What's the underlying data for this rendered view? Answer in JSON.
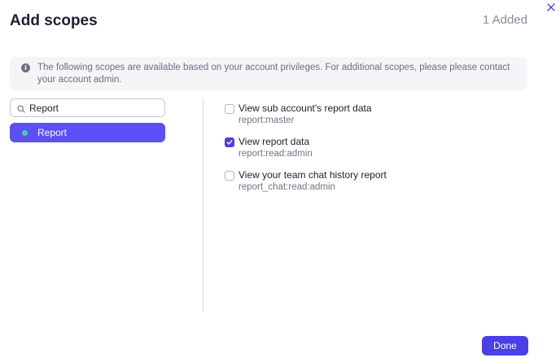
{
  "dialog": {
    "title": "Add scopes",
    "added_count": "1 Added",
    "close_icon": "close-icon"
  },
  "info": {
    "icon": "info-icon",
    "icon_glyph": "i",
    "text": "The following scopes are available based on your account privileges. For additional scopes, please please contact your account admin."
  },
  "search": {
    "value": "Report",
    "placeholder": "",
    "icon": "search-icon"
  },
  "categories": [
    {
      "label": "Report",
      "selected": true,
      "dot_color": "#3ed29a"
    }
  ],
  "scopes": [
    {
      "title": "View sub account's report data",
      "code": "report:master",
      "checked": false
    },
    {
      "title": "View report data",
      "code": "report:read:admin",
      "checked": true
    },
    {
      "title": "View your team chat history report",
      "code": "report_chat:read:admin",
      "checked": false
    }
  ],
  "footer": {
    "done_label": "Done"
  },
  "colors": {
    "accent": "#4a3fe8",
    "selected_item": "#5b4ff5",
    "status_dot": "#3ed29a"
  }
}
